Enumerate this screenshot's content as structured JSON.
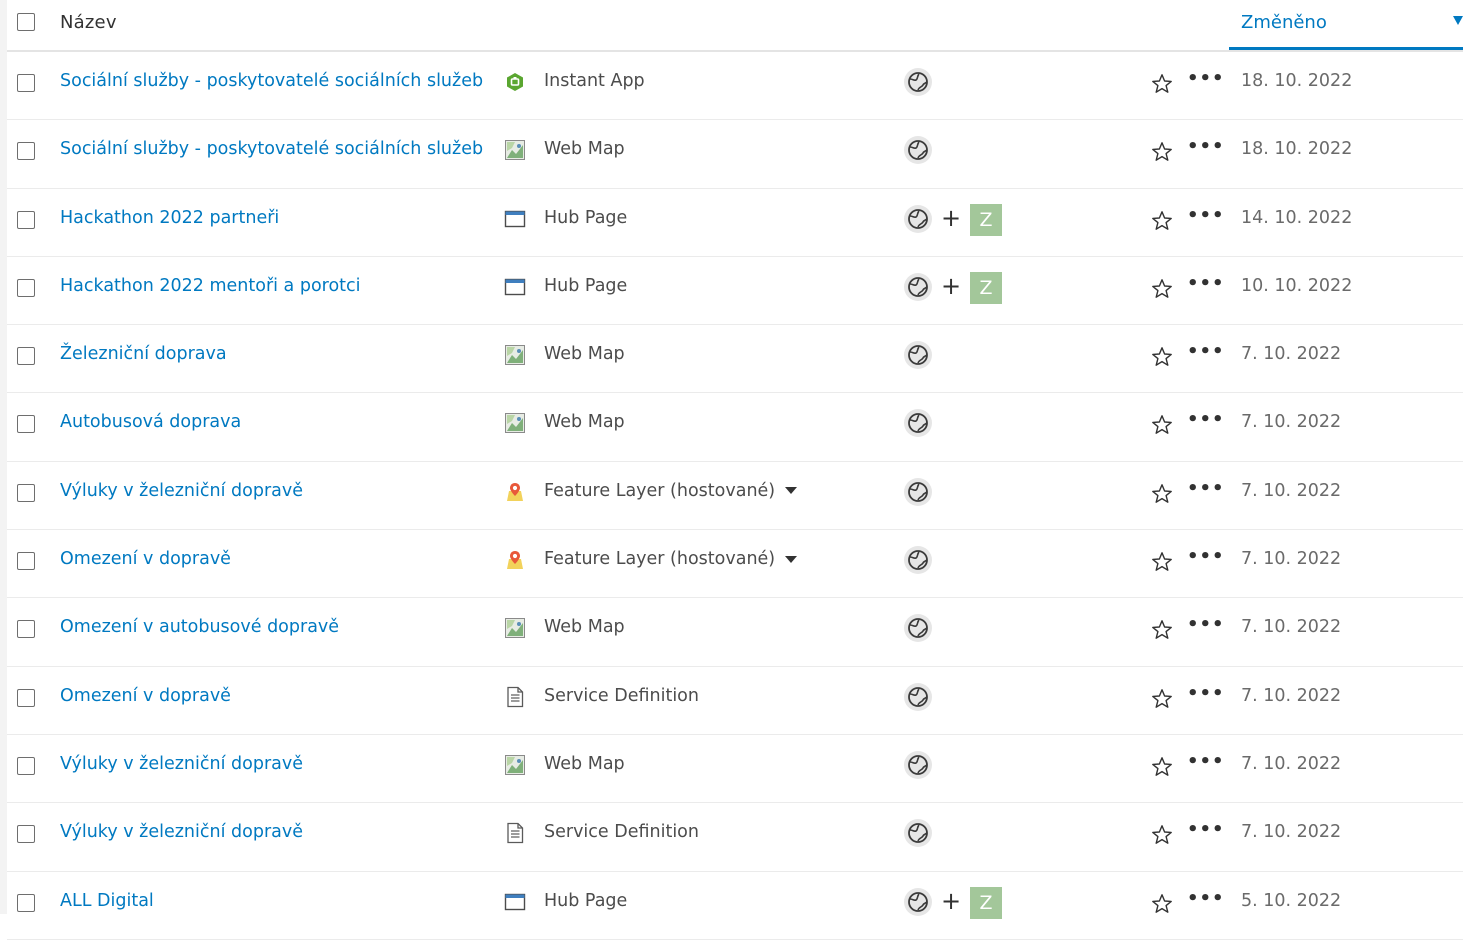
{
  "header": {
    "name_label": "Název",
    "modified_label": "Změněno"
  },
  "colors": {
    "link": "#0079c1",
    "accent": "#0079c1",
    "group_badge": "#a3c79a"
  },
  "rows": [
    {
      "title": "Sociální služby - poskytovatelé sociálních služeb",
      "type": "Instant App",
      "type_icon": "instant-app-icon",
      "dropdown": false,
      "group": "",
      "date": "18. 10. 2022"
    },
    {
      "title": "Sociální služby - poskytovatelé sociálních služeb",
      "type": "Web Map",
      "type_icon": "web-map-icon",
      "dropdown": false,
      "group": "",
      "date": "18. 10. 2022"
    },
    {
      "title": "Hackathon 2022 partneři",
      "type": "Hub Page",
      "type_icon": "hub-page-icon",
      "dropdown": false,
      "group": "Z",
      "date": "14. 10. 2022"
    },
    {
      "title": "Hackathon 2022 mentoři a porotci",
      "type": "Hub Page",
      "type_icon": "hub-page-icon",
      "dropdown": false,
      "group": "Z",
      "date": "10. 10. 2022"
    },
    {
      "title": "Železniční doprava",
      "type": "Web Map",
      "type_icon": "web-map-icon",
      "dropdown": false,
      "group": "",
      "date": "7. 10. 2022"
    },
    {
      "title": "Autobusová doprava",
      "type": "Web Map",
      "type_icon": "web-map-icon",
      "dropdown": false,
      "group": "",
      "date": "7. 10. 2022"
    },
    {
      "title": "Výluky v železniční dopravě",
      "type": "Feature Layer (hostované)",
      "type_icon": "feature-layer-icon",
      "dropdown": true,
      "group": "",
      "date": "7. 10. 2022"
    },
    {
      "title": "Omezení v dopravě",
      "type": "Feature Layer (hostované)",
      "type_icon": "feature-layer-icon",
      "dropdown": true,
      "group": "",
      "date": "7. 10. 2022"
    },
    {
      "title": "Omezení v autobusové dopravě",
      "type": "Web Map",
      "type_icon": "web-map-icon",
      "dropdown": false,
      "group": "",
      "date": "7. 10. 2022"
    },
    {
      "title": "Omezení v dopravě",
      "type": "Service Definition",
      "type_icon": "service-definition-icon",
      "dropdown": false,
      "group": "",
      "date": "7. 10. 2022"
    },
    {
      "title": "Výluky v železniční dopravě",
      "type": "Web Map",
      "type_icon": "web-map-icon",
      "dropdown": false,
      "group": "",
      "date": "7. 10. 2022"
    },
    {
      "title": "Výluky v železniční dopravě",
      "type": "Service Definition",
      "type_icon": "service-definition-icon",
      "dropdown": false,
      "group": "",
      "date": "7. 10. 2022"
    },
    {
      "title": "ALL Digital",
      "type": "Hub Page",
      "type_icon": "hub-page-icon",
      "dropdown": false,
      "group": "Z",
      "date": "5. 10. 2022"
    }
  ]
}
